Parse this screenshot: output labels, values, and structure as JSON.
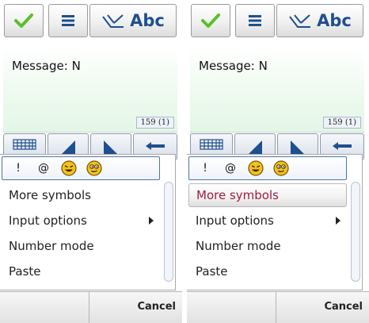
{
  "toolbar": {
    "ok_icon": "checkmark-icon",
    "menu_icon": "menu-lines-icon",
    "input_mode_icon": "pen-tick-icon",
    "input_mode_label": "Abc"
  },
  "message": {
    "text": "Message: N",
    "counter": "159 (1)"
  },
  "keyboard_icons": [
    "keypad-grid-icon",
    "arrow-left-icon",
    "arrow-right-icon",
    "backspace-icon"
  ],
  "popup": {
    "symbols": [
      "!",
      "@"
    ],
    "smiley_icons": [
      "smiley-grin-icon",
      "smiley-wink-icon"
    ],
    "items": [
      {
        "label": "More symbols",
        "submenu": false
      },
      {
        "label": "Input options",
        "submenu": true
      },
      {
        "label": "Number mode",
        "submenu": false
      },
      {
        "label": "Paste",
        "submenu": false
      }
    ]
  },
  "panels": [
    {
      "highlighted_item": "none"
    },
    {
      "highlighted_item": "More symbols"
    }
  ],
  "softkeys": {
    "left": "",
    "right": "Cancel"
  },
  "colors": {
    "accent_green": "#5bbf2a",
    "toolbar_icon_blue": "#1e4f8f",
    "highlight_text": "#a0203a",
    "message_bg": "#e3f6e6"
  }
}
